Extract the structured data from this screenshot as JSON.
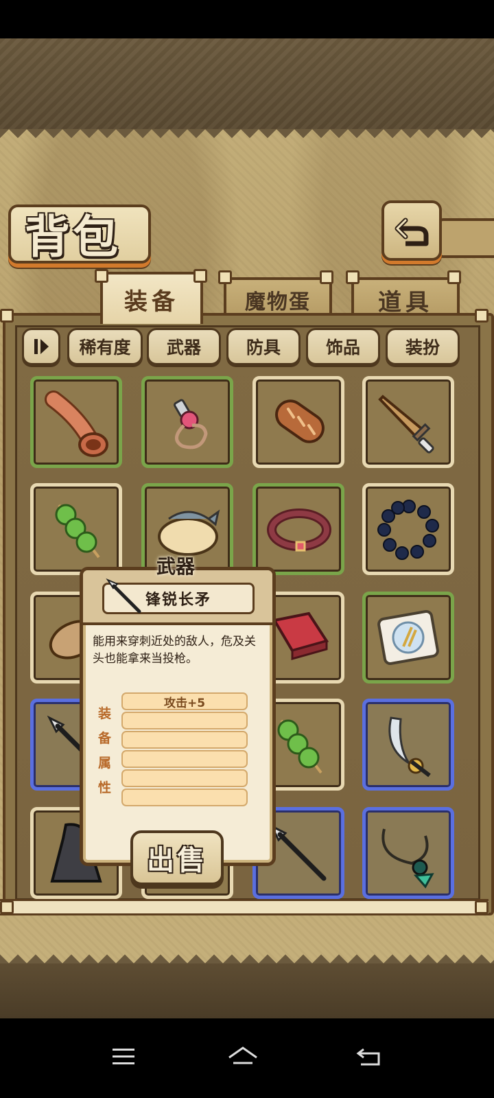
{
  "screen": {
    "title": "背包"
  },
  "tabs": [
    {
      "label": "装备",
      "active": true
    },
    {
      "label": "魔物蛋",
      "active": false
    },
    {
      "label": "道具",
      "active": false
    }
  ],
  "filters": {
    "toggle_icon": "sort-toggle-icon",
    "buttons": [
      "稀有度",
      "武器",
      "防具",
      "饰品",
      "装扮"
    ]
  },
  "inventory": {
    "rarity_colors": {
      "green": "#7aa54a",
      "cream": "#e8d9b2",
      "blue": "#5a6fe0"
    },
    "items": [
      {
        "icon": "horn-icon",
        "rarity": "green"
      },
      {
        "icon": "whistle-icon",
        "rarity": "green"
      },
      {
        "icon": "bread-icon",
        "rarity": "cream"
      },
      {
        "icon": "wooden-sword-icon",
        "rarity": "cream"
      },
      {
        "icon": "veggie-skewer-icon",
        "rarity": "cream"
      },
      {
        "icon": "fish-pie-icon",
        "rarity": "green"
      },
      {
        "icon": "collar-icon",
        "rarity": "green"
      },
      {
        "icon": "bead-bracelet-icon",
        "rarity": "cream"
      },
      {
        "icon": "potato-icon",
        "rarity": "cream"
      },
      {
        "icon": "red-block-icon",
        "rarity": "cream"
      },
      {
        "icon": "wheat-plate-icon",
        "rarity": "green"
      },
      {
        "icon": "spear-icon",
        "rarity": "blue"
      },
      {
        "icon": "veggie-skewer-icon",
        "rarity": "cream"
      },
      {
        "icon": "scimitar-icon",
        "rarity": "blue"
      },
      {
        "icon": "hooded-cloak-icon",
        "rarity": "cream"
      },
      {
        "icon": "spear-icon",
        "rarity": "blue"
      },
      {
        "icon": "spider-pendant-icon",
        "rarity": "blue"
      }
    ]
  },
  "tooltip": {
    "category": "武器",
    "item_icon": "spear-icon",
    "item_name": "锋锐长矛",
    "description": "能用来穿刺近处的敌人，危及关头也能拿来当投枪。",
    "attributes_label": [
      "装",
      "备",
      "属",
      "性"
    ],
    "attributes": [
      "攻击+5",
      "",
      "",
      "",
      "",
      ""
    ],
    "sell_label": "出售"
  },
  "navigation": {
    "icons": [
      "menu-icon",
      "home-icon",
      "back-nav-icon"
    ]
  }
}
